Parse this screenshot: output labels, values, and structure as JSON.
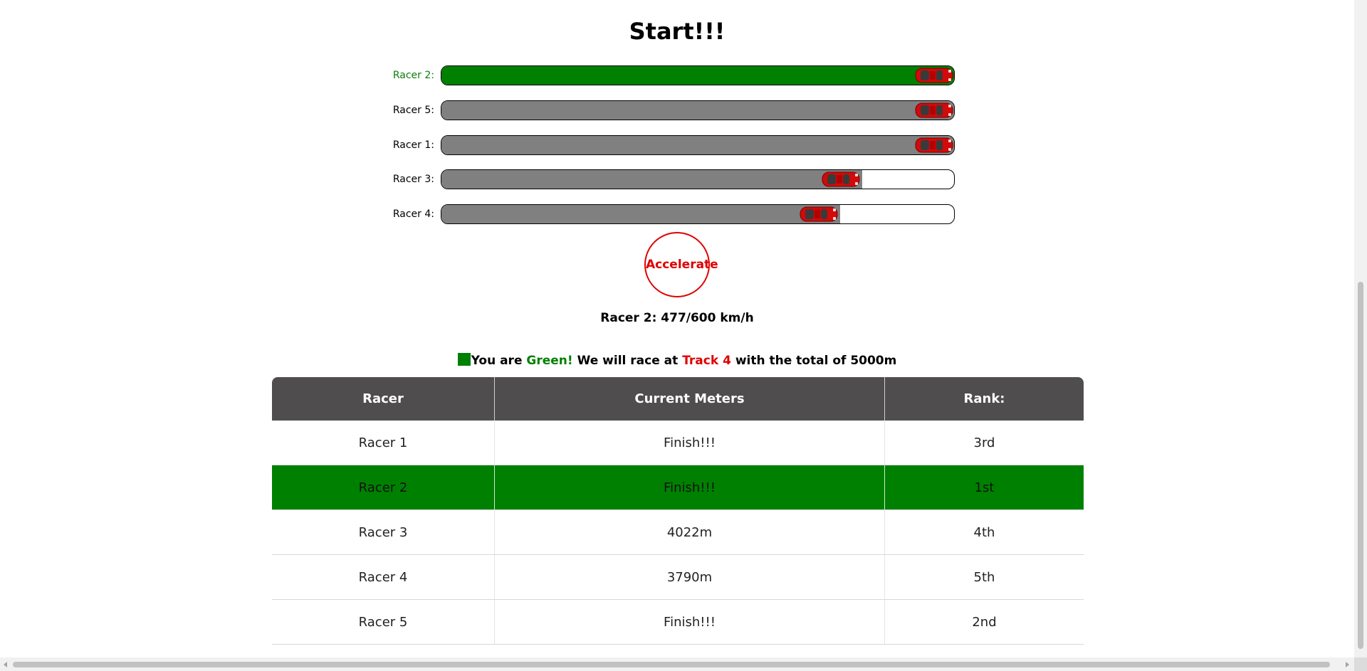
{
  "page": {
    "title": "Start!!!"
  },
  "race_tracks": [
    {
      "label": "Racer 2:",
      "progress": 1.0,
      "is_player": true
    },
    {
      "label": "Racer 5:",
      "progress": 1.0,
      "is_player": false
    },
    {
      "label": "Racer 1:",
      "progress": 1.0,
      "is_player": false
    },
    {
      "label": "Racer 3:",
      "progress": 0.8044,
      "is_player": false
    },
    {
      "label": "Racer 4:",
      "progress": 0.758,
      "is_player": false
    }
  ],
  "controls": {
    "accelerate_label": "Accelerate"
  },
  "speed": {
    "readout": "Racer 2: 477/600 km/h"
  },
  "race_info": {
    "part1": "You are ",
    "color_name": "Green!",
    "part2": " We will race at ",
    "track_name": "Track 4",
    "part3": " with the total of 5000m"
  },
  "standings": {
    "headers": [
      "Racer",
      "Current Meters",
      "Rank:"
    ],
    "rows": [
      {
        "racer": "Racer 1",
        "meters": "Finish!!!",
        "rank": "3rd",
        "is_player": false
      },
      {
        "racer": "Racer 2",
        "meters": "Finish!!!",
        "rank": "1st",
        "is_player": true
      },
      {
        "racer": "Racer 3",
        "meters": "4022m",
        "rank": "4th",
        "is_player": false
      },
      {
        "racer": "Racer 4",
        "meters": "3790m",
        "rank": "5th",
        "is_player": false
      },
      {
        "racer": "Racer 5",
        "meters": "Finish!!!",
        "rank": "2nd",
        "is_player": false
      }
    ]
  },
  "colors": {
    "player": "#008000",
    "opponent_fill": "#808080",
    "accent_red": "#e00000",
    "table_header": "#4f4d4e"
  },
  "icons": {
    "car": "race-car-icon",
    "player_swatch": "green-swatch"
  }
}
